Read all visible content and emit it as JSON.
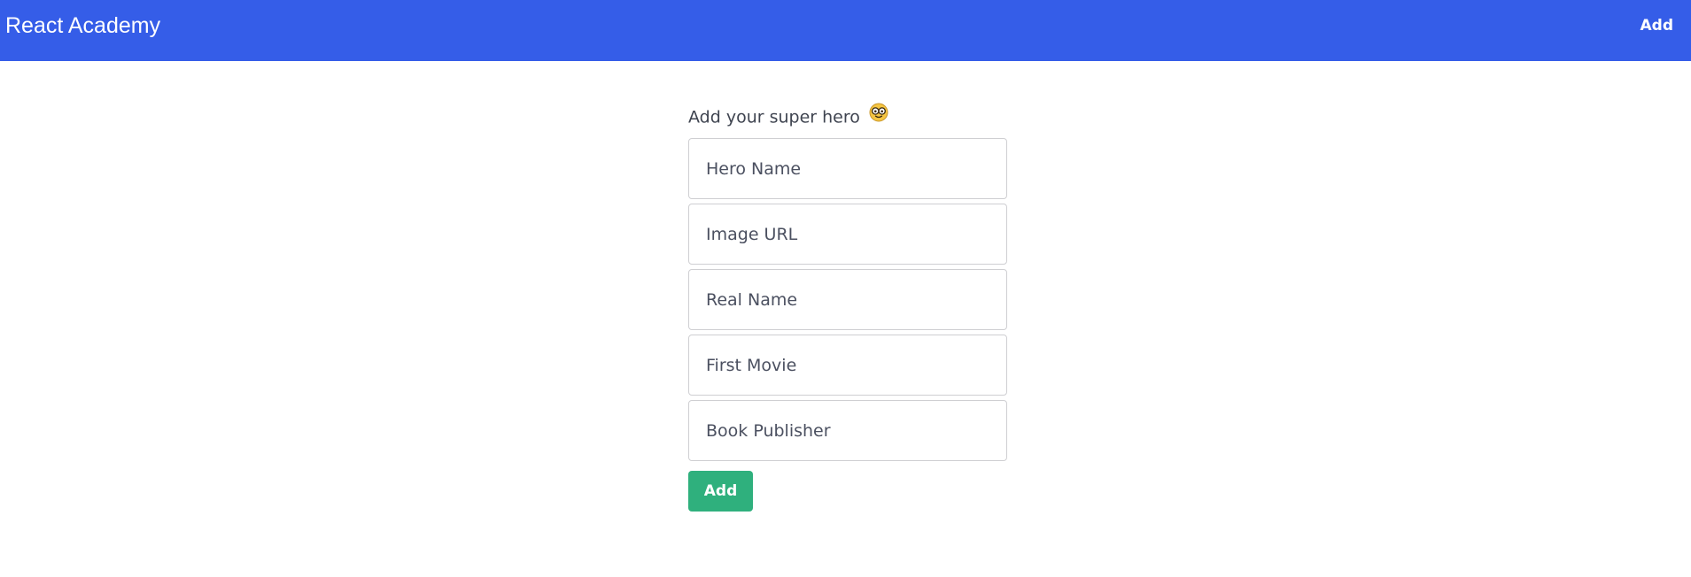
{
  "navbar": {
    "brand": "React Academy",
    "add_link": "Add",
    "background_color": "#355de8"
  },
  "form": {
    "title": "Add your super hero",
    "title_icon": "face-with-glasses-icon",
    "fields": [
      {
        "placeholder": "Hero Name",
        "value": ""
      },
      {
        "placeholder": "Image URL",
        "value": ""
      },
      {
        "placeholder": "Real Name",
        "value": ""
      },
      {
        "placeholder": "First Movie",
        "value": ""
      },
      {
        "placeholder": "Book Publisher",
        "value": ""
      }
    ],
    "submit_label": "Add",
    "submit_color": "#2fb07d"
  }
}
